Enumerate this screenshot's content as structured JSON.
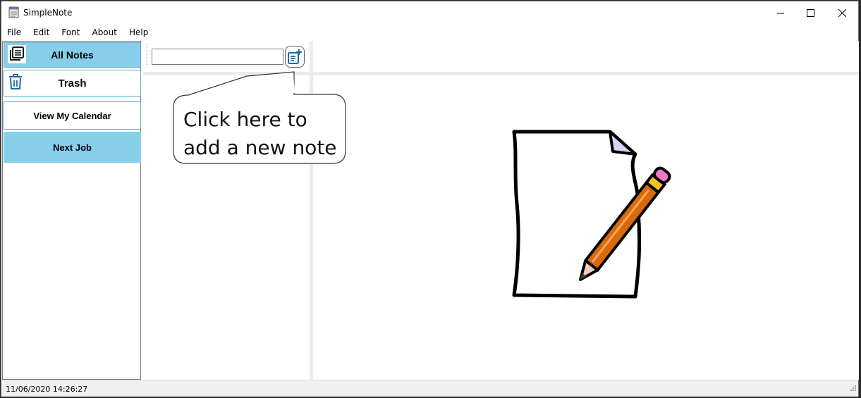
{
  "window": {
    "title": "SimpleNote"
  },
  "menu": [
    "File",
    "Edit",
    "Font",
    "About",
    "Help"
  ],
  "sidebar": {
    "all_notes": "All Notes",
    "trash": "Trash",
    "calendar": "View My Calendar",
    "next_job": "Next Job"
  },
  "search": {
    "value": "",
    "placeholder": ""
  },
  "callout": {
    "line1": "Click here to",
    "line2": "add a new note"
  },
  "status": {
    "datetime": "11/06/2020 14:26:27"
  },
  "icons": {
    "app": "notepad-icon",
    "all_notes": "notes-stack-icon",
    "trash": "trash-icon",
    "add_note": "add-note-icon",
    "illustration": "paper-and-pencil-illustration"
  },
  "colors": {
    "nav_active": "#87ceeb",
    "nav_border": "#5aa8d0",
    "icon_blue": "#1e6aa8"
  }
}
